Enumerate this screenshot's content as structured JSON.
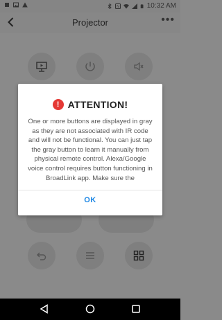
{
  "status_bar": {
    "time": "10:32 AM",
    "left_icons": [
      "notification-icon",
      "photo-icon",
      "alert-icon"
    ],
    "right_icons": [
      "bluetooth-icon",
      "nfc-icon",
      "wifi-icon",
      "signal-icon",
      "battery-icon"
    ]
  },
  "app_bar": {
    "title": "Projector",
    "back_icon": "back-arrow-icon",
    "more_icon": "more-dots-icon",
    "more_label": "•••"
  },
  "remote": {
    "top_row": [
      "projector-input-icon",
      "power-icon",
      "mute-icon"
    ],
    "bottom_row": [
      "return-icon",
      "menu-icon",
      "grid-icon"
    ]
  },
  "dialog": {
    "icon": "exclamation-icon",
    "icon_glyph": "!",
    "title": "ATTENTION!",
    "body": "One or more buttons are displayed in gray as they are not associated with IR code and will not be functional. You can just tap the gray button to learn it manually from physical remote control. Alexa/Google voice control requires button functioning in BroadLink app. Make sure the",
    "ok_label": "OK",
    "colors": {
      "accent": "#1e88e5",
      "warning": "#e53935"
    }
  },
  "nav_bar": {
    "icons": [
      "nav-back-icon",
      "nav-home-icon",
      "nav-recents-icon"
    ]
  }
}
